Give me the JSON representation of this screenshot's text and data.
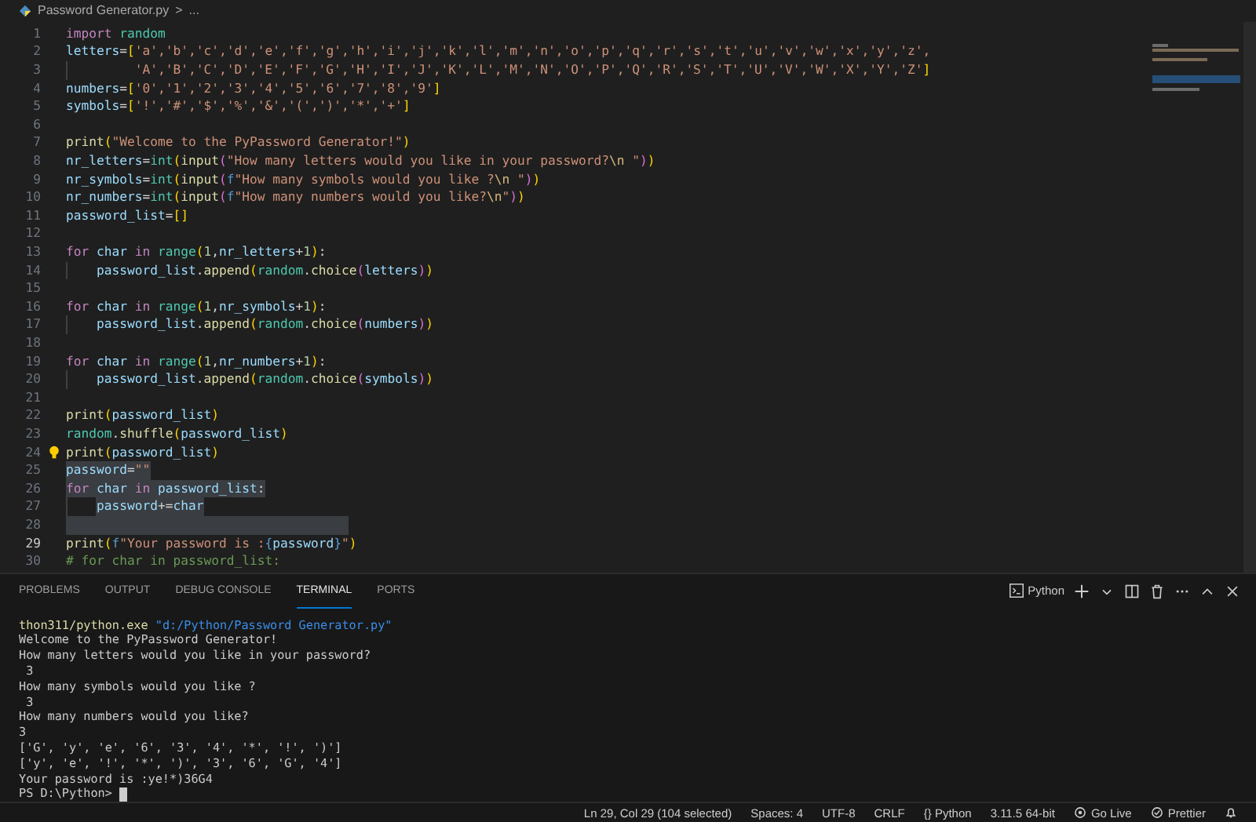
{
  "breadcrumb": {
    "file": "Password Generator.py",
    "separator": ">",
    "more": "..."
  },
  "editor": {
    "lines": [
      {
        "n": "1",
        "selected": false,
        "current": false,
        "tokens": [
          {
            "text": "import",
            "kind": "kw"
          },
          {
            "text": " random",
            "kind": "mod"
          }
        ]
      },
      {
        "n": "2",
        "selected": false,
        "current": false,
        "tokens": [
          {
            "text": "letters",
            "kind": "var"
          },
          {
            "text": "=",
            "kind": "op"
          },
          {
            "text": "[",
            "kind": "b1"
          },
          {
            "text": "'a','b','c','d','e','f','g','h','i','j','k','l','m','n','o','p','q','r','s','t','u','v','w','x','y','z',",
            "kind": "str"
          }
        ]
      },
      {
        "n": "3",
        "selected": false,
        "current": false,
        "continuation": true,
        "tokens": [
          {
            "text": "'A','B','C','D','E','F','G','H','I','J','K','L','M','N','O','P','Q','R','S','T','U','V','W','X','Y','Z'",
            "kind": "str"
          },
          {
            "text": "]",
            "kind": "b1"
          }
        ]
      },
      {
        "n": "4",
        "selected": false,
        "current": false,
        "tokens": [
          {
            "text": "numbers",
            "kind": "var"
          },
          {
            "text": "=",
            "kind": "op"
          },
          {
            "text": "[",
            "kind": "b1"
          },
          {
            "text": "'0','1','2','3','4','5','6','7','8','9'",
            "kind": "str"
          },
          {
            "text": "]",
            "kind": "b1"
          }
        ]
      },
      {
        "n": "5",
        "selected": false,
        "current": false,
        "tokens": [
          {
            "text": "symbols",
            "kind": "var"
          },
          {
            "text": "=",
            "kind": "op"
          },
          {
            "text": "[",
            "kind": "b1"
          },
          {
            "text": "'!','#','$','%','&','(',')','*','+'",
            "kind": "str"
          },
          {
            "text": "]",
            "kind": "b1"
          }
        ]
      },
      {
        "n": "6",
        "selected": false,
        "current": false
      },
      {
        "n": "7",
        "selected": false,
        "current": false,
        "tokens": [
          {
            "text": "print",
            "kind": "fn"
          },
          {
            "text": "(",
            "kind": "b1"
          },
          {
            "text": "\"Welcome to the PyPassword Generator!\"",
            "kind": "str"
          },
          {
            "text": ")",
            "kind": "b1"
          }
        ]
      },
      {
        "n": "8",
        "selected": false,
        "current": false,
        "tokens": [
          {
            "text": "nr_letters",
            "kind": "var"
          },
          {
            "text": "=",
            "kind": "op"
          },
          {
            "text": "int",
            "kind": "mod"
          },
          {
            "text": "(",
            "kind": "b1"
          },
          {
            "text": "input",
            "kind": "fn"
          },
          {
            "text": "(",
            "kind": "b2"
          },
          {
            "text": "\"How many letters would you like in your password?",
            "kind": "str"
          },
          {
            "text": "\\n",
            "kind": "esc"
          },
          {
            "text": " \"",
            "kind": "str"
          },
          {
            "text": ")",
            "kind": "b2"
          },
          {
            "text": ")",
            "kind": "b1"
          }
        ]
      },
      {
        "n": "9",
        "selected": false,
        "current": false,
        "tokens": [
          {
            "text": "nr_symbols",
            "kind": "var"
          },
          {
            "text": "=",
            "kind": "op"
          },
          {
            "text": "int",
            "kind": "mod"
          },
          {
            "text": "(",
            "kind": "b1"
          },
          {
            "text": "input",
            "kind": "fn"
          },
          {
            "text": "(",
            "kind": "b2"
          },
          {
            "text": "f",
            "kind": "kb"
          },
          {
            "text": "\"How many symbols would you like ?",
            "kind": "str"
          },
          {
            "text": "\\n",
            "kind": "esc"
          },
          {
            "text": " \"",
            "kind": "str"
          },
          {
            "text": ")",
            "kind": "b2"
          },
          {
            "text": ")",
            "kind": "b1"
          }
        ]
      },
      {
        "n": "10",
        "selected": false,
        "current": false,
        "tokens": [
          {
            "text": "nr_numbers",
            "kind": "var"
          },
          {
            "text": "=",
            "kind": "op"
          },
          {
            "text": "int",
            "kind": "mod"
          },
          {
            "text": "(",
            "kind": "b1"
          },
          {
            "text": "input",
            "kind": "fn"
          },
          {
            "text": "(",
            "kind": "b2"
          },
          {
            "text": "f",
            "kind": "kb"
          },
          {
            "text": "\"How many numbers would you like?",
            "kind": "str"
          },
          {
            "text": "\\n",
            "kind": "esc"
          },
          {
            "text": "\"",
            "kind": "str"
          },
          {
            "text": ")",
            "kind": "b2"
          },
          {
            "text": ")",
            "kind": "b1"
          }
        ]
      },
      {
        "n": "11",
        "selected": false,
        "current": false,
        "tokens": [
          {
            "text": "password_list",
            "kind": "var"
          },
          {
            "text": "=",
            "kind": "op"
          },
          {
            "text": "[]",
            "kind": "b1"
          }
        ]
      },
      {
        "n": "12",
        "selected": false,
        "current": false
      },
      {
        "n": "13",
        "selected": false,
        "current": false,
        "tokens": [
          {
            "text": "for",
            "kind": "kw"
          },
          {
            "text": " char ",
            "kind": "var"
          },
          {
            "text": "in",
            "kind": "kw"
          },
          {
            "text": " range",
            "kind": "mod"
          },
          {
            "text": "(",
            "kind": "b1"
          },
          {
            "text": "1",
            "kind": "num"
          },
          {
            "text": ",",
            "kind": "op"
          },
          {
            "text": "nr_letters",
            "kind": "var"
          },
          {
            "text": "+",
            "kind": "op"
          },
          {
            "text": "1",
            "kind": "num"
          },
          {
            "text": ")",
            "kind": "b1"
          },
          {
            "text": ":",
            "kind": "op"
          }
        ]
      },
      {
        "n": "14",
        "selected": false,
        "current": false,
        "indented": true,
        "tokens": [
          {
            "text": "password_list",
            "kind": "var"
          },
          {
            "text": ".",
            "kind": "op"
          },
          {
            "text": "append",
            "kind": "fn"
          },
          {
            "text": "(",
            "kind": "b1"
          },
          {
            "text": "random",
            "kind": "mod"
          },
          {
            "text": ".",
            "kind": "op"
          },
          {
            "text": "choice",
            "kind": "fn"
          },
          {
            "text": "(",
            "kind": "b2"
          },
          {
            "text": "letters",
            "kind": "var"
          },
          {
            "text": ")",
            "kind": "b2"
          },
          {
            "text": ")",
            "kind": "b1"
          }
        ]
      },
      {
        "n": "15",
        "selected": false,
        "current": false
      },
      {
        "n": "16",
        "selected": false,
        "current": false,
        "tokens": [
          {
            "text": "for",
            "kind": "kw"
          },
          {
            "text": " char ",
            "kind": "var"
          },
          {
            "text": "in",
            "kind": "kw"
          },
          {
            "text": " range",
            "kind": "mod"
          },
          {
            "text": "(",
            "kind": "b1"
          },
          {
            "text": "1",
            "kind": "num"
          },
          {
            "text": ",",
            "kind": "op"
          },
          {
            "text": "nr_symbols",
            "kind": "var"
          },
          {
            "text": "+",
            "kind": "op"
          },
          {
            "text": "1",
            "kind": "num"
          },
          {
            "text": ")",
            "kind": "b1"
          },
          {
            "text": ":",
            "kind": "op"
          }
        ]
      },
      {
        "n": "17",
        "selected": false,
        "current": false,
        "indented": true,
        "tokens": [
          {
            "text": "password_list",
            "kind": "var"
          },
          {
            "text": ".",
            "kind": "op"
          },
          {
            "text": "append",
            "kind": "fn"
          },
          {
            "text": "(",
            "kind": "b1"
          },
          {
            "text": "random",
            "kind": "mod"
          },
          {
            "text": ".",
            "kind": "op"
          },
          {
            "text": "choice",
            "kind": "fn"
          },
          {
            "text": "(",
            "kind": "b2"
          },
          {
            "text": "numbers",
            "kind": "var"
          },
          {
            "text": ")",
            "kind": "b2"
          },
          {
            "text": ")",
            "kind": "b1"
          }
        ]
      },
      {
        "n": "18",
        "selected": false,
        "current": false
      },
      {
        "n": "19",
        "selected": false,
        "current": false,
        "tokens": [
          {
            "text": "for",
            "kind": "kw"
          },
          {
            "text": " char ",
            "kind": "var"
          },
          {
            "text": "in",
            "kind": "kw"
          },
          {
            "text": " range",
            "kind": "mod"
          },
          {
            "text": "(",
            "kind": "b1"
          },
          {
            "text": "1",
            "kind": "num"
          },
          {
            "text": ",",
            "kind": "op"
          },
          {
            "text": "nr_numbers",
            "kind": "var"
          },
          {
            "text": "+",
            "kind": "op"
          },
          {
            "text": "1",
            "kind": "num"
          },
          {
            "text": ")",
            "kind": "b1"
          },
          {
            "text": ":",
            "kind": "op"
          }
        ]
      },
      {
        "n": "20",
        "selected": false,
        "current": false,
        "indented": true,
        "tokens": [
          {
            "text": "password_list",
            "kind": "var"
          },
          {
            "text": ".",
            "kind": "op"
          },
          {
            "text": "append",
            "kind": "fn"
          },
          {
            "text": "(",
            "kind": "b1"
          },
          {
            "text": "random",
            "kind": "mod"
          },
          {
            "text": ".",
            "kind": "op"
          },
          {
            "text": "choice",
            "kind": "fn"
          },
          {
            "text": "(",
            "kind": "b2"
          },
          {
            "text": "symbols",
            "kind": "var"
          },
          {
            "text": ")",
            "kind": "b2"
          },
          {
            "text": ")",
            "kind": "b1"
          }
        ]
      },
      {
        "n": "21",
        "selected": false,
        "current": false
      },
      {
        "n": "22",
        "selected": false,
        "current": false,
        "tokens": [
          {
            "text": "print",
            "kind": "fn"
          },
          {
            "text": "(",
            "kind": "b1"
          },
          {
            "text": "password_list",
            "kind": "var"
          },
          {
            "text": ")",
            "kind": "b1"
          }
        ]
      },
      {
        "n": "23",
        "selected": false,
        "current": false,
        "tokens": [
          {
            "text": "random",
            "kind": "mod"
          },
          {
            "text": ".",
            "kind": "op"
          },
          {
            "text": "shuffle",
            "kind": "fn"
          },
          {
            "text": "(",
            "kind": "b1"
          },
          {
            "text": "password_list",
            "kind": "var"
          },
          {
            "text": ")",
            "kind": "b1"
          }
        ]
      },
      {
        "n": "24",
        "selected": false,
        "current": false,
        "lightbulb": true,
        "tokens": [
          {
            "text": "print",
            "kind": "fn"
          },
          {
            "text": "(",
            "kind": "b1"
          },
          {
            "text": "password_list",
            "kind": "var"
          },
          {
            "text": ")",
            "kind": "b1"
          }
        ]
      },
      {
        "n": "25",
        "selected": true,
        "current": false,
        "tokens": [
          {
            "text": "password",
            "kind": "var"
          },
          {
            "text": "=",
            "kind": "op"
          },
          {
            "text": "\"\"",
            "kind": "str"
          }
        ]
      },
      {
        "n": "26",
        "selected": true,
        "current": false,
        "tokens": [
          {
            "text": "for",
            "kind": "kw"
          },
          {
            "text": " char ",
            "kind": "var"
          },
          {
            "text": "in",
            "kind": "kw"
          },
          {
            "text": " password_list",
            "kind": "var"
          },
          {
            "text": ":",
            "kind": "op"
          }
        ]
      },
      {
        "n": "27",
        "selected": true,
        "current": false,
        "indented": true,
        "tokens": [
          {
            "text": "password",
            "kind": "var"
          },
          {
            "text": "+=",
            "kind": "op"
          },
          {
            "text": "char",
            "kind": "var"
          }
        ]
      },
      {
        "n": "28",
        "selected": true,
        "current": false
      },
      {
        "n": "29",
        "selected": false,
        "current": true,
        "tokens": [
          {
            "text": "print",
            "kind": "fn"
          },
          {
            "text": "(",
            "kind": "b1"
          },
          {
            "text": "f",
            "kind": "kb"
          },
          {
            "text": "\"Your password is :",
            "kind": "str"
          },
          {
            "text": "{",
            "kind": "kb"
          },
          {
            "text": "password",
            "kind": "var"
          },
          {
            "text": "}",
            "kind": "kb"
          },
          {
            "text": "\"",
            "kind": "str"
          },
          {
            "text": ")",
            "kind": "b1"
          }
        ]
      },
      {
        "n": "30",
        "selected": false,
        "current": false,
        "tokens": [
          {
            "text": "# for char in password_list:",
            "kind": "com"
          }
        ]
      }
    ]
  },
  "panel": {
    "tabs": [
      {
        "label": "PROBLEMS",
        "selected": false
      },
      {
        "label": "OUTPUT",
        "selected": false
      },
      {
        "label": "DEBUG CONSOLE",
        "selected": false
      },
      {
        "label": "TERMINAL",
        "selected": true
      },
      {
        "label": "PORTS",
        "selected": false
      }
    ],
    "terminal_name": "Python",
    "terminal": [
      {
        "tokens": [
          {
            "text": "thon311/python.exe",
            "kind": "cmd"
          },
          {
            "text": " \"d:/Python/Password Generator.py\"",
            "kind": "path"
          }
        ]
      },
      {
        "tokens": [
          {
            "text": "Welcome to the PyPassword Generator!",
            "kind": "out"
          }
        ]
      },
      {
        "tokens": [
          {
            "text": "How many letters would you like in your password?",
            "kind": "out"
          }
        ]
      },
      {
        "tokens": [
          {
            "text": " 3",
            "kind": "out"
          }
        ]
      },
      {
        "tokens": [
          {
            "text": "How many symbols would you like ?",
            "kind": "out"
          }
        ]
      },
      {
        "tokens": [
          {
            "text": " 3",
            "kind": "out"
          }
        ]
      },
      {
        "tokens": [
          {
            "text": "How many numbers would you like?",
            "kind": "out"
          }
        ]
      },
      {
        "tokens": [
          {
            "text": "3",
            "kind": "out"
          }
        ]
      },
      {
        "tokens": [
          {
            "text": "['G', 'y', 'e', '6', '3', '4', '*', '!', ')']",
            "kind": "out"
          }
        ]
      },
      {
        "tokens": [
          {
            "text": "['y', 'e', '!', '*', ')', '3', '6', 'G', '4']",
            "kind": "out"
          }
        ]
      },
      {
        "tokens": [
          {
            "text": "Your password is :ye!*)36G4",
            "kind": "out"
          }
        ]
      },
      {
        "tokens": [
          {
            "text": "PS D:\\Python> ",
            "kind": "out"
          }
        ]
      }
    ]
  },
  "status_bar": [
    {
      "text": "Ln 29, Col 29 (104 selected)",
      "kind": "plain"
    },
    {
      "text": "Spaces: 4",
      "kind": "plain"
    },
    {
      "text": "UTF-8",
      "kind": "plain"
    },
    {
      "text": "CRLF",
      "kind": "plain"
    },
    {
      "text": "{} Python",
      "kind": "plain"
    },
    {
      "text": "3.11.5 64-bit",
      "kind": "plain"
    },
    {
      "text": "Go Live",
      "kind": "live"
    },
    {
      "text": "Prettier",
      "kind": "prettier"
    }
  ]
}
